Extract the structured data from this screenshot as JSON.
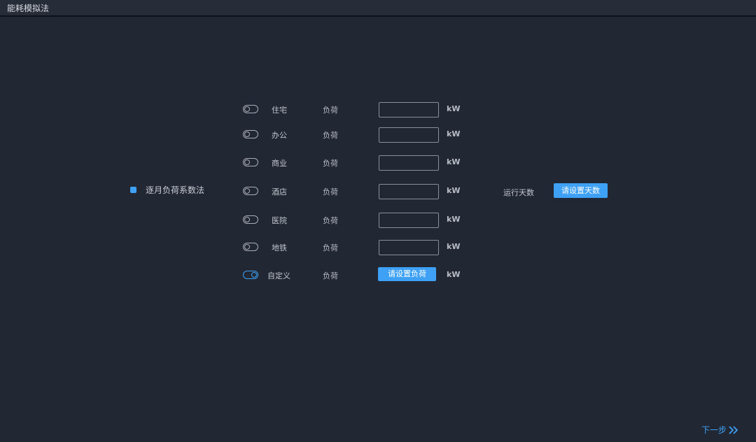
{
  "window": {
    "title": "能耗模拟法"
  },
  "method": {
    "label": "逐月负荷系数法",
    "accent_color": "#3ea1f5"
  },
  "rows": [
    {
      "category": "住宅",
      "load_label": "负荷",
      "value": "",
      "unit": "kW",
      "enabled": false
    },
    {
      "category": "办公",
      "load_label": "负荷",
      "value": "",
      "unit": "kW",
      "enabled": false
    },
    {
      "category": "商业",
      "load_label": "负荷",
      "value": "",
      "unit": "kW",
      "enabled": false
    },
    {
      "category": "酒店",
      "load_label": "负荷",
      "value": "",
      "unit": "kW",
      "enabled": false
    },
    {
      "category": "医院",
      "load_label": "负荷",
      "value": "",
      "unit": "kW",
      "enabled": false
    },
    {
      "category": "地铁",
      "load_label": "负荷",
      "value": "",
      "unit": "kW",
      "enabled": false
    },
    {
      "category": "自定义",
      "load_label": "负荷",
      "button_label": "请设置负荷",
      "unit": "kW",
      "enabled": true
    }
  ],
  "run_days": {
    "label": "运行天数",
    "button_label": "请设置天数"
  },
  "footer": {
    "next_label": "下一步",
    "next_icon": "double-chevron-right-icon"
  }
}
